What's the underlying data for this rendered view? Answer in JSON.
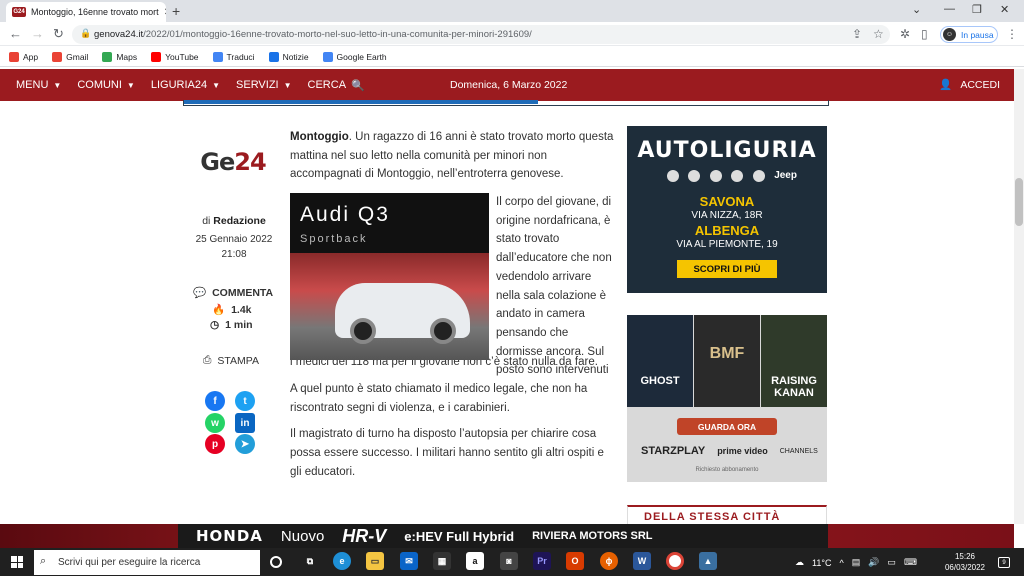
{
  "browser": {
    "tab_title": "Montoggio, 16enne trovato mort",
    "tab_favicon": "G24",
    "url_domain": "genova24.it",
    "url_path": "/2022/01/montoggio-16enne-trovato-morto-nel-suo-letto-in-una-comunita-per-minori-291609/",
    "profile_status": "In pausa",
    "bookmarks": [
      {
        "label": "App",
        "color": "#e94235"
      },
      {
        "label": "Gmail",
        "color": "#ea4335"
      },
      {
        "label": "Maps",
        "color": "#34a853"
      },
      {
        "label": "YouTube",
        "color": "#ff0000"
      },
      {
        "label": "Traduci",
        "color": "#4285f4"
      },
      {
        "label": "Notizie",
        "color": "#1a73e8"
      },
      {
        "label": "Google Earth",
        "color": "#4285f4"
      }
    ]
  },
  "site": {
    "nav": [
      {
        "label": "MENU"
      },
      {
        "label": "COMUNI"
      },
      {
        "label": "LIGURIA24"
      },
      {
        "label": "SERVIZI"
      },
      {
        "label": "CERCA"
      }
    ],
    "date": "Domenica, 6 Marzo 2022",
    "login": "ACCEDI",
    "read_progress": 0.55
  },
  "meta": {
    "logo_a": "Ge",
    "logo_b": "24",
    "by_prefix": "di",
    "author": "Redazione",
    "date": "25 Gennaio 2022",
    "time": "21:08",
    "comment_label": "COMMENTA",
    "views": "1.4k",
    "read_time": "1 min",
    "print_label": "STAMPA",
    "share": [
      {
        "icon": "facebook-icon",
        "glyph": "f",
        "color": "#1877f2"
      },
      {
        "icon": "twitter-icon",
        "glyph": "t",
        "color": "#1da1f2"
      },
      {
        "icon": "whatsapp-icon",
        "glyph": "w",
        "color": "#25d366"
      },
      {
        "icon": "linkedin-icon",
        "glyph": "in",
        "color": "#0a66c2"
      },
      {
        "icon": "pinterest-icon",
        "glyph": "p",
        "color": "#e60023"
      },
      {
        "icon": "telegram-icon",
        "glyph": "➤",
        "color": "#229ed9"
      }
    ]
  },
  "article": {
    "lead_bold": "Montoggio",
    "lead_rest": ". Un ragazzo di 16 anni è stato trovato morto questa mattina nel suo letto nella comunità per minori non accompagnati di Montoggio, nell’entroterra genovese.",
    "p2_side": "Il corpo del giovane, di origine nordafricana, è stato trovato dall’educatore che non vedendolo arrivare nella sala colazione è andato in camera pensando che dormisse ancora. Sul posto sono intervenuti",
    "p2_tail": "i medici del 118 ma per il giovane non c’è stato nulla da fare.",
    "p3": "A quel punto è stato chiamato il medico legale, che non ha riscontrato segni di violenza, e i carabinieri.",
    "p4": "Il magistrato di turno ha disposto l’autopsia per chiarire cosa possa essere successo. I militari hanno sentito gli altri ospiti e gli educatori."
  },
  "inline_ad": {
    "title": "Audi Q3",
    "subtitle": "Sportback"
  },
  "ad_autoliguria": {
    "brand": "AUTOLIGURIA",
    "jeep": "Jeep",
    "city1": "SAVONA",
    "street1": "VIA NIZZA, 18R",
    "city2": "ALBENGA",
    "street2": "VIA AL PIEMONTE, 19",
    "cta": "SCOPRI DI PIÙ"
  },
  "ad_starz": {
    "show1": "GHOST",
    "show2": "BMF",
    "show3": "RAISING KANAN",
    "cta": "GUARDA ORA",
    "starz": "STARZPLAY",
    "prime": "prime video",
    "channels": "CHANNELS",
    "note": "Richiesto abbonamento"
  },
  "related_heading": "DELLA STESSA CITTÀ",
  "honda_banner": {
    "brand": "HONDA",
    "nuovo": "Nuovo",
    "model": "HR-V",
    "hybrid": "e:HEV Full Hybrid",
    "dealer": "RIVIERA MOTORS SRL"
  },
  "taskbar": {
    "search_placeholder": "Scrivi qui per eseguire la ricerca",
    "weather": "11°C",
    "time": "15:26",
    "date": "06/03/2022",
    "notifications": "9"
  }
}
